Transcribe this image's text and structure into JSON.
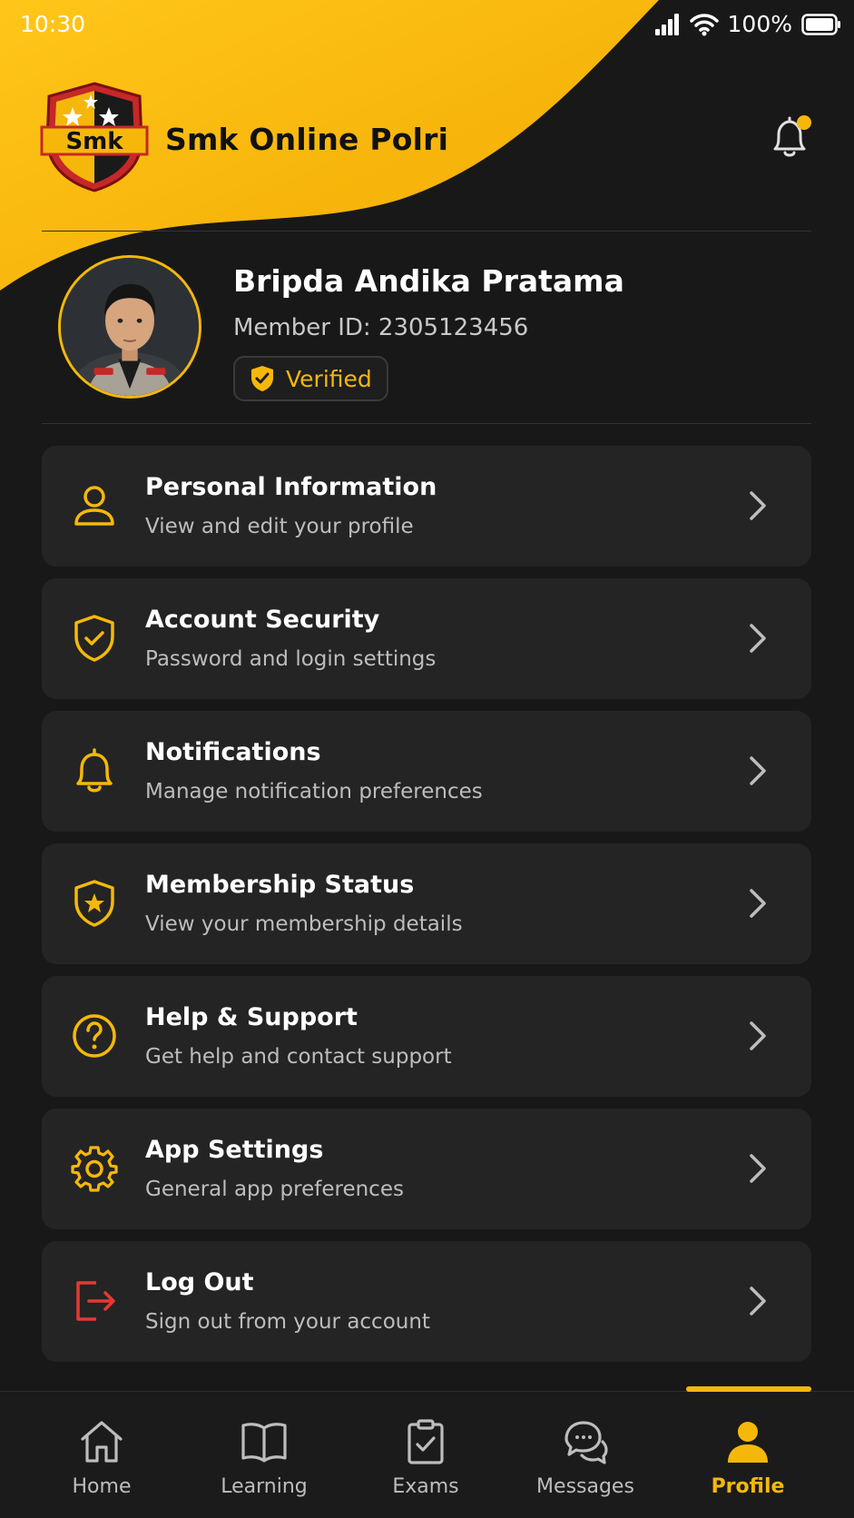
{
  "status_bar": {
    "time": "10:30",
    "battery": "100%"
  },
  "header": {
    "app_title": "Smk Online Polri",
    "logo_text": "Smk"
  },
  "profile": {
    "name": "Bripda Andika Pratama",
    "member_id": "Member ID: 2305123456",
    "badge": "Verified"
  },
  "menu": [
    {
      "title": "Personal Information",
      "subtitle": "View and edit your profile",
      "icon": "user-icon"
    },
    {
      "title": "Account Security",
      "subtitle": "Password and login settings",
      "icon": "shield-check-icon"
    },
    {
      "title": "Notifications",
      "subtitle": "Manage notification preferences",
      "icon": "bell-icon"
    },
    {
      "title": "Membership Status",
      "subtitle": "View your membership details",
      "icon": "shield-star-icon"
    },
    {
      "title": "Help & Support",
      "subtitle": "Get help and contact support",
      "icon": "question-icon"
    },
    {
      "title": "App Settings",
      "subtitle": "General app preferences",
      "icon": "gear-icon"
    },
    {
      "title": "Log Out",
      "subtitle": "Sign out from your account",
      "icon": "logout-icon"
    }
  ],
  "nav": [
    {
      "label": "Home",
      "icon": "home-icon"
    },
    {
      "label": "Learning",
      "icon": "book-icon"
    },
    {
      "label": "Exams",
      "icon": "clipboard-check-icon"
    },
    {
      "label": "Messages",
      "icon": "chat-icon"
    },
    {
      "label": "Profile",
      "icon": "profile-icon",
      "active": true
    }
  ],
  "colors": {
    "accent": "#f5b80a",
    "background": "#181818",
    "card": "#242424",
    "danger": "#e53935"
  }
}
